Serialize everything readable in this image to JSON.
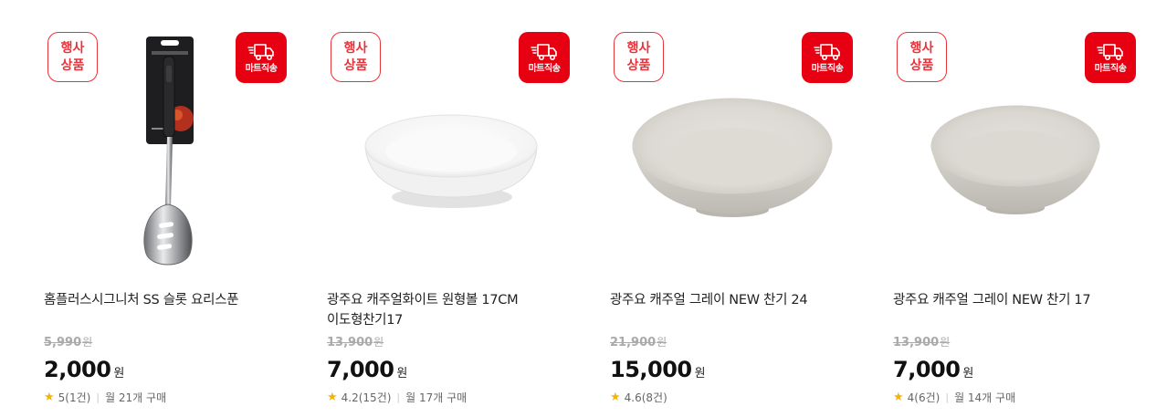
{
  "badges": {
    "event_line1": "행사",
    "event_line2": "상품",
    "mart_label": "마트직송",
    "mart_icon": "delivery-truck-icon"
  },
  "colors": {
    "accent_red": "#e60012",
    "event_red": "#e5343a",
    "star": "#f5b400"
  },
  "products": [
    {
      "name": "홈플러스시그니처 SS 슬롯 요리스푼",
      "original_price": "5,990",
      "price": "2,000",
      "currency": "원",
      "rating": "5(1건)",
      "monthly_sales": "월 21개 구매",
      "image": "slotted-spoon"
    },
    {
      "name": "광주요 캐주얼화이트 원형볼 17CM 이도형찬기17",
      "original_price": "13,900",
      "price": "7,000",
      "currency": "원",
      "rating": "4.2(15건)",
      "monthly_sales": "월 17개 구매",
      "image": "white-bowl"
    },
    {
      "name": "광주요 캐주얼 그레이 NEW 찬기 24",
      "original_price": "21,900",
      "price": "15,000",
      "currency": "원",
      "rating": "4.6(8건)",
      "monthly_sales": "",
      "image": "gray-bowl-large"
    },
    {
      "name": "광주요 캐주얼 그레이 NEW 찬기 17",
      "original_price": "13,900",
      "price": "7,000",
      "currency": "원",
      "rating": "4(6건)",
      "monthly_sales": "월 14개 구매",
      "image": "gray-bowl-small"
    }
  ]
}
